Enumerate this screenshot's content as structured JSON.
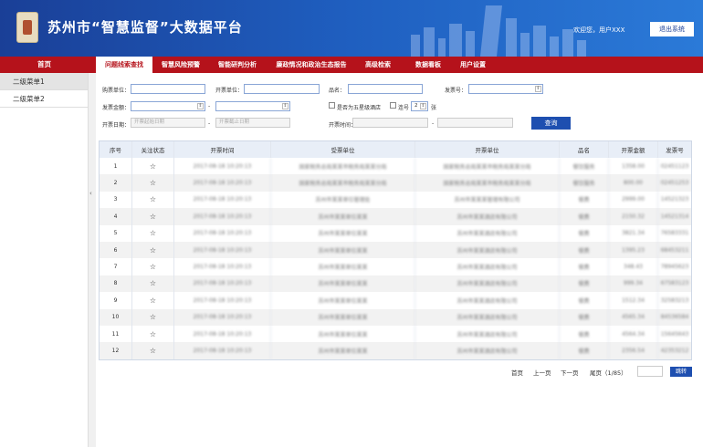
{
  "header": {
    "title": "苏州市“智慧监督”大数据平台",
    "welcome": "欢迎您，用户XXX",
    "logout": "退出系统"
  },
  "nav": {
    "home": "首页",
    "tabs": [
      "问题线索查找",
      "智慧风险预警",
      "智能研判分析",
      "廉政情况和政治生态报告",
      "高级检索",
      "数据看板",
      "用户设置"
    ]
  },
  "sidebar": {
    "items": [
      "二级菜单1",
      "二级菜单2"
    ]
  },
  "form": {
    "buyer_label": "购票单位：",
    "seller_label": "开票单位：",
    "item_label": "品名：",
    "invoice_label": "发票号：",
    "amount_label": "发票金额：",
    "dash1": "-",
    "five_star": "是否为五星级酒店",
    "consecutive": "连号",
    "consecutive_val": "2",
    "consecutive_unit": "张",
    "date_label": "开票日期：",
    "date_start": "开票起始日期",
    "dash2": "-",
    "date_end": "开票截止日期",
    "time_label": "开票时间：",
    "dash3": "-",
    "query": "查询"
  },
  "table": {
    "headers": [
      "序号",
      "关注状态",
      "开票时间",
      "受票单位",
      "开票单位",
      "品名",
      "开票金额",
      "发票号"
    ],
    "rows": [
      [
        "1",
        "☆",
        "2017-08-18 10:20:13",
        "国家税务总局某某市税务局某某分局",
        "国家税务总局某某市税务局某某分局",
        "餐饮服务",
        "1358.00",
        "02451123"
      ],
      [
        "2",
        "☆",
        "2017-08-18 10:20:13",
        "国家税务总局某某市税务局某某分局",
        "国家税务总局某某市税务局某某分局",
        "餐饮服务",
        "800.00",
        "02451253"
      ],
      [
        "3",
        "☆",
        "2017-08-18 10:20:13",
        "苏州市某某单位管理处",
        "苏州市某某某管理有限公司",
        "餐费",
        "2999.00",
        "14521323"
      ],
      [
        "4",
        "☆",
        "2017-08-18 10:20:13",
        "苏州市某某单位某某",
        "苏州市某某酒店有限公司",
        "餐费",
        "2150.32",
        "14521314"
      ],
      [
        "5",
        "☆",
        "2017-08-18 10:20:13",
        "苏州市某某单位某某",
        "苏州市某某酒店有限公司",
        "餐费",
        "3821.34",
        "76583331"
      ],
      [
        "6",
        "☆",
        "2017-08-18 10:20:13",
        "苏州市某某单位某某",
        "苏州市某某酒店有限公司",
        "餐费",
        "1395.23",
        "68453211"
      ],
      [
        "7",
        "☆",
        "2017-08-18 10:20:13",
        "苏州市某某单位某某",
        "苏州市某某酒店有限公司",
        "餐费",
        "348.43",
        "78945623"
      ],
      [
        "8",
        "☆",
        "2017-08-18 10:20:13",
        "苏州市某某单位某某",
        "苏州市某某酒店有限公司",
        "餐费",
        "999.34",
        "67583123"
      ],
      [
        "9",
        "☆",
        "2017-08-18 10:20:13",
        "苏州市某某单位某某",
        "苏州市某某酒店有限公司",
        "餐费",
        "1512.34",
        "32583213"
      ],
      [
        "10",
        "☆",
        "2017-08-18 10:20:13",
        "苏州市某某单位某某",
        "苏州市某某酒店有限公司",
        "餐费",
        "4565.34",
        "84536584"
      ],
      [
        "11",
        "☆",
        "2017-08-18 10:20:13",
        "苏州市某某单位某某",
        "苏州市某某酒店有限公司",
        "餐费",
        "4564.34",
        "15645643"
      ],
      [
        "12",
        "☆",
        "2017-08-18 10:20:13",
        "苏州市某某单位某某",
        "苏州市某某酒店有限公司",
        "餐费",
        "2356.54",
        "42353212"
      ]
    ]
  },
  "pager": {
    "first": "首页",
    "prev": "上一页",
    "next": "下一页",
    "last": "尾页（1/85）",
    "jump": "跳转"
  }
}
